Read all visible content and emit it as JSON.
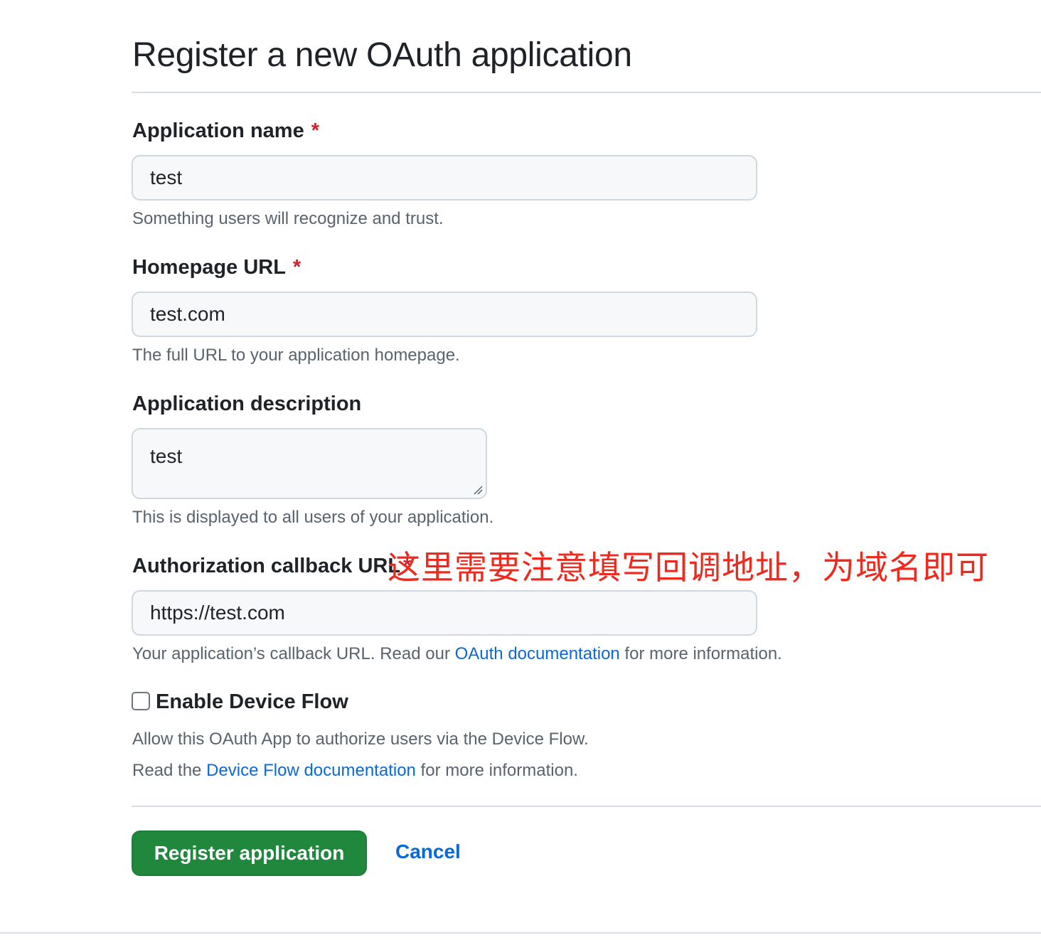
{
  "page": {
    "title": "Register a new OAuth application"
  },
  "form": {
    "app_name": {
      "label": "Application name",
      "required_mark": "*",
      "value": "test",
      "note": "Something users will recognize and trust."
    },
    "homepage_url": {
      "label": "Homepage URL",
      "required_mark": "*",
      "value": "test.com",
      "note": "The full URL to your application homepage."
    },
    "description": {
      "label": "Application description",
      "value": "test",
      "note": "This is displayed to all users of your application."
    },
    "callback_url": {
      "label": "Authorization callback URL",
      "required_mark": "*",
      "value": "https://test.com",
      "note_before": "Your application’s callback URL. Read our ",
      "note_link": "OAuth documentation",
      "note_after": " for more information."
    },
    "device_flow": {
      "label": "Enable Device Flow",
      "checked": false,
      "note_line1": "Allow this OAuth App to authorize users via the Device Flow.",
      "note_line2_before": "Read the ",
      "note_line2_link": "Device Flow documentation",
      "note_line2_after": " for more information."
    }
  },
  "annotation": {
    "text": "这里需要注意填写回调地址，为域名即可",
    "color": "#ee2a1f"
  },
  "actions": {
    "register_label": "Register application",
    "cancel_label": "Cancel"
  },
  "colors": {
    "primary_button": "#1f883d",
    "link": "#0969da",
    "required": "#cf222e"
  }
}
